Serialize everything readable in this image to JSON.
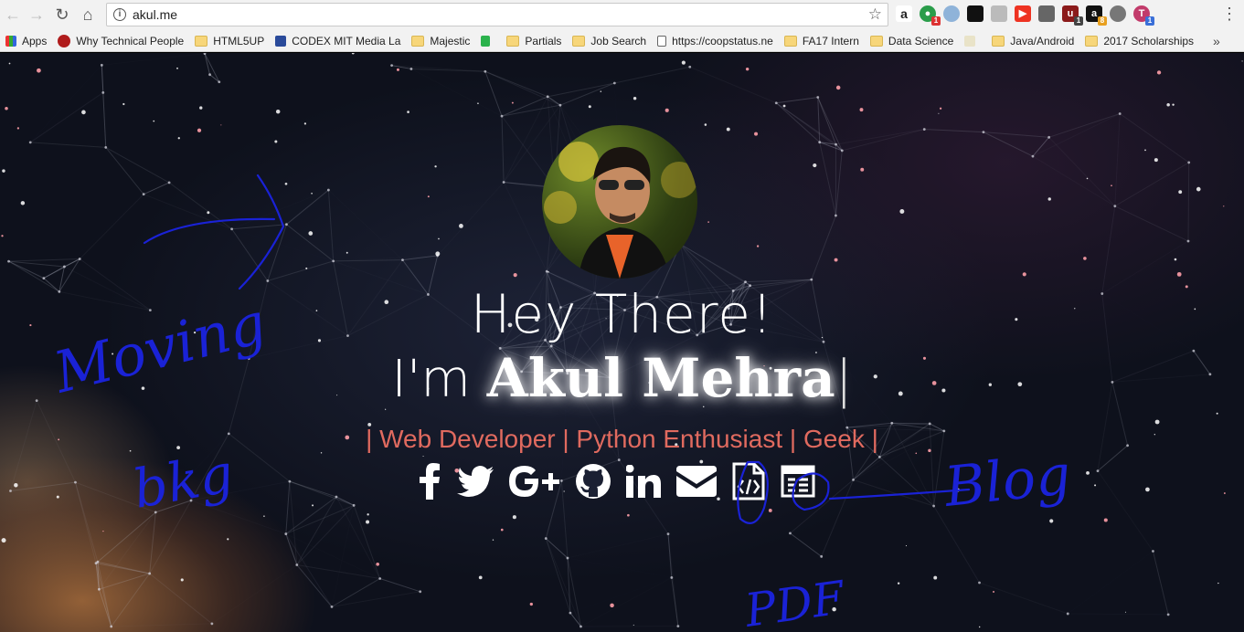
{
  "browser": {
    "url": "akul.me",
    "bookmarks": [
      {
        "label": "Apps",
        "icon": "apps-grid-icon"
      },
      {
        "label": "Why Technical People",
        "icon": "site-icon"
      },
      {
        "label": "HTML5UP",
        "icon": "folder-icon"
      },
      {
        "label": "CODEX MIT Media La",
        "icon": "site-icon"
      },
      {
        "label": "Majestic",
        "icon": "folder-icon"
      },
      {
        "label": "",
        "icon": "feedly-icon"
      },
      {
        "label": "Partials",
        "icon": "folder-icon"
      },
      {
        "label": "Job Search",
        "icon": "folder-icon"
      },
      {
        "label": "https://coopstatus.ne",
        "icon": "page-icon"
      },
      {
        "label": "FA17 Intern",
        "icon": "folder-icon"
      },
      {
        "label": "Data Science",
        "icon": "folder-icon"
      },
      {
        "label": "",
        "icon": "goodreads-icon"
      },
      {
        "label": "Java/Android",
        "icon": "folder-icon"
      },
      {
        "label": "2017 Scholarships",
        "icon": "folder-icon"
      }
    ],
    "overflow": "»",
    "extension_badges": [
      "1",
      "1",
      "8",
      "1"
    ]
  },
  "hero": {
    "line1": "Hey There!",
    "line2_prefix": "I'm ",
    "name": "Akul Mehra",
    "cursor": "|",
    "tagline": "| Web Developer | Python Enthusiast | Geek |"
  },
  "annotations": {
    "moving": "Moving",
    "bkg": "bkg",
    "blog": "Blog",
    "pdf": "PDF"
  },
  "colors": {
    "tagline": "#e06a5f",
    "annotation_ink": "#1a22d6"
  }
}
